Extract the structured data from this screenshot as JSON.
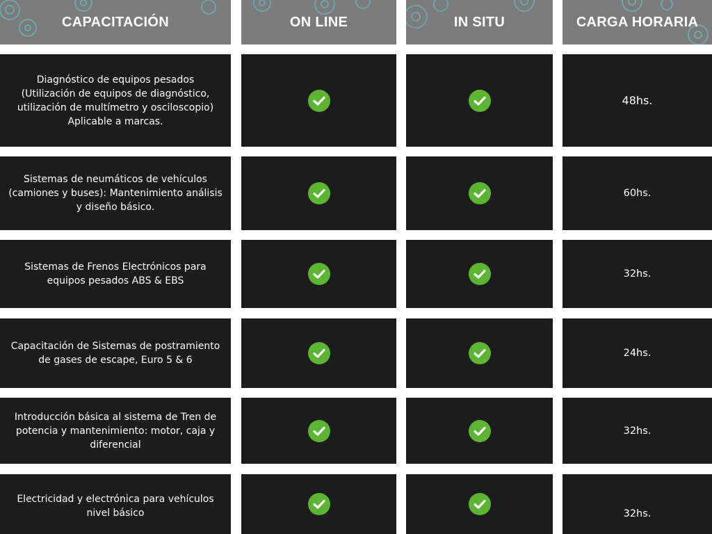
{
  "header": {
    "capacitacion": "CAPACITACIÓN",
    "online": "ON LINE",
    "insitu": "IN SITU",
    "carga": "CARGA HORARIA"
  },
  "colors": {
    "header_bg": "#7b7b7b",
    "cell_bg": "#1c1c1c",
    "check_green": "#5bb531",
    "gear_accent": "#5fd0d8"
  },
  "icons": {
    "check": "check-circle-icon",
    "gear": "gear-icon"
  },
  "rows": [
    {
      "course": "Diagnóstico de equipos pesados (Utilización de equipos de diagnóstico, utilización de multímetro y osciloscopio) Aplicable a marcas.",
      "online": true,
      "insitu": true,
      "hours": "48hs."
    },
    {
      "course": "Sistemas de neumáticos de vehículos (camiones y buses): Mantenimiento análisis y diseño básico.",
      "online": true,
      "insitu": true,
      "hours": "60hs."
    },
    {
      "course": "Sistemas de Frenos Electrónicos para equipos pesados ABS & EBS",
      "online": true,
      "insitu": true,
      "hours": "32hs."
    },
    {
      "course": "Capacitación de Sistemas de postramiento de gases de escape, Euro 5 & 6",
      "online": true,
      "insitu": true,
      "hours": "24hs."
    },
    {
      "course": "Introducción básica al sistema de Tren de potencia y mantenimiento: motor, caja y diferencial",
      "online": true,
      "insitu": true,
      "hours": "32hs."
    },
    {
      "course": "Electricidad y electrónica para vehículos nivel básico",
      "online": true,
      "insitu": true,
      "hours": "32hs."
    }
  ]
}
